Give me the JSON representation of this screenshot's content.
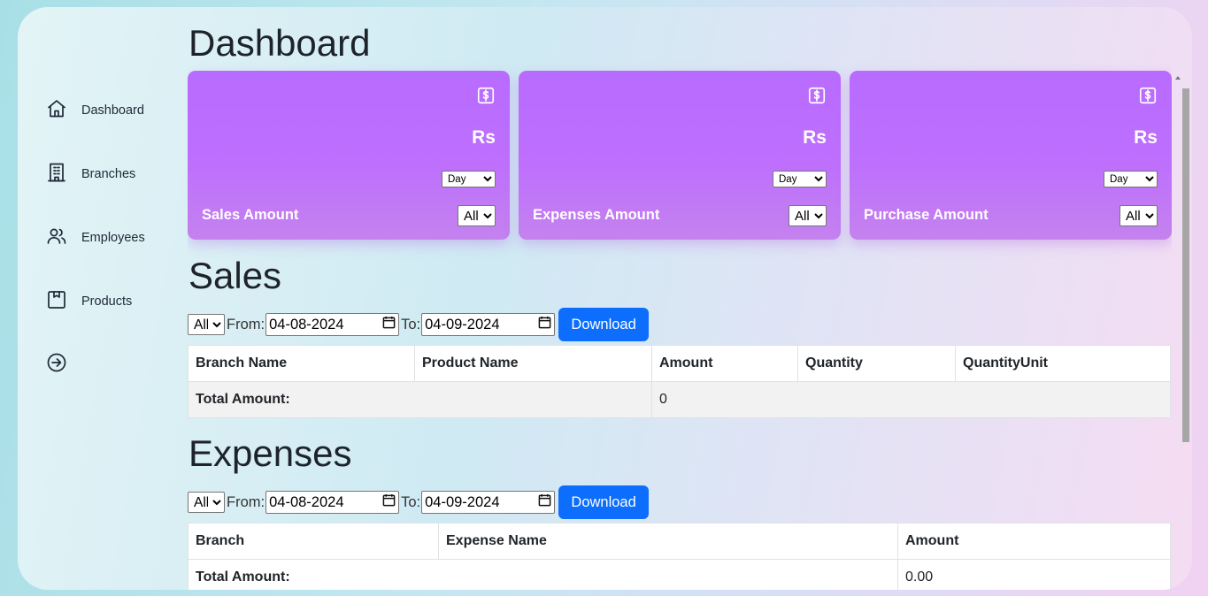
{
  "sidebar": {
    "items": [
      {
        "label": "Dashboard",
        "icon": "home-icon"
      },
      {
        "label": "Branches",
        "icon": "building-icon"
      },
      {
        "label": "Employees",
        "icon": "users-icon"
      },
      {
        "label": "Products",
        "icon": "box-icon"
      },
      {
        "label": "",
        "icon": "logout-icon"
      }
    ]
  },
  "page": {
    "title": "Dashboard"
  },
  "cards": [
    {
      "title": "Sales Amount",
      "currency": "Rs",
      "period": "Day",
      "branch": "All",
      "icon": "dollar-icon"
    },
    {
      "title": "Expenses Amount",
      "currency": "Rs",
      "period": "Day",
      "branch": "All",
      "icon": "dollar-icon"
    },
    {
      "title": "Purchase Amount",
      "currency": "Rs",
      "period": "Day",
      "branch": "All",
      "icon": "dollar-icon"
    }
  ],
  "sales": {
    "heading": "Sales",
    "branch_filter": "All",
    "from_label": "From:",
    "from_date": "04-08-2024",
    "to_label": "To:",
    "to_date": "04-09-2024",
    "download_label": "Download",
    "columns": [
      "Branch Name",
      "Product Name",
      "Amount",
      "Quantity",
      "QuantityUnit"
    ],
    "total_label": "Total Amount:",
    "total_value": "0"
  },
  "expenses": {
    "heading": "Expenses",
    "branch_filter": "All",
    "from_label": "From:",
    "from_date": "04-08-2024",
    "to_label": "To:",
    "to_date": "04-09-2024",
    "download_label": "Download",
    "columns": [
      "Branch",
      "Expense Name",
      "Amount"
    ],
    "total_label": "Total Amount:",
    "total_value": "0.00"
  },
  "colors": {
    "card_purple": "#b86bff",
    "primary_button": "#0d6efd"
  }
}
